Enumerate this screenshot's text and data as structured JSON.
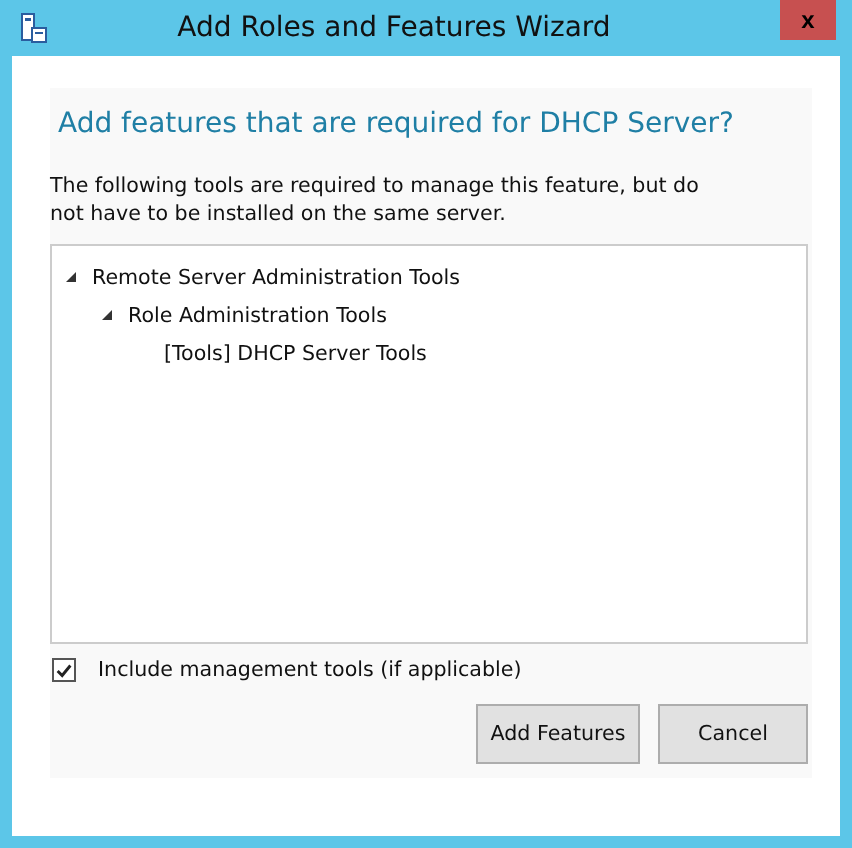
{
  "window": {
    "title": "Add Roles and Features Wizard",
    "close": "x"
  },
  "heading": "Add features that are required for DHCP Server?",
  "description": "The following tools are required to manage this feature, but do not have to be installed on the same server.",
  "tree": [
    {
      "label": "Remote Server Administration Tools",
      "expanded": true,
      "children": [
        {
          "label": "Role Administration Tools",
          "expanded": true,
          "children": [
            {
              "label": "[Tools] DHCP Server Tools"
            }
          ]
        }
      ]
    }
  ],
  "include_tools": {
    "label": "Include management tools (if applicable)",
    "checked": true
  },
  "buttons": [
    "Add Features",
    "Cancel"
  ]
}
